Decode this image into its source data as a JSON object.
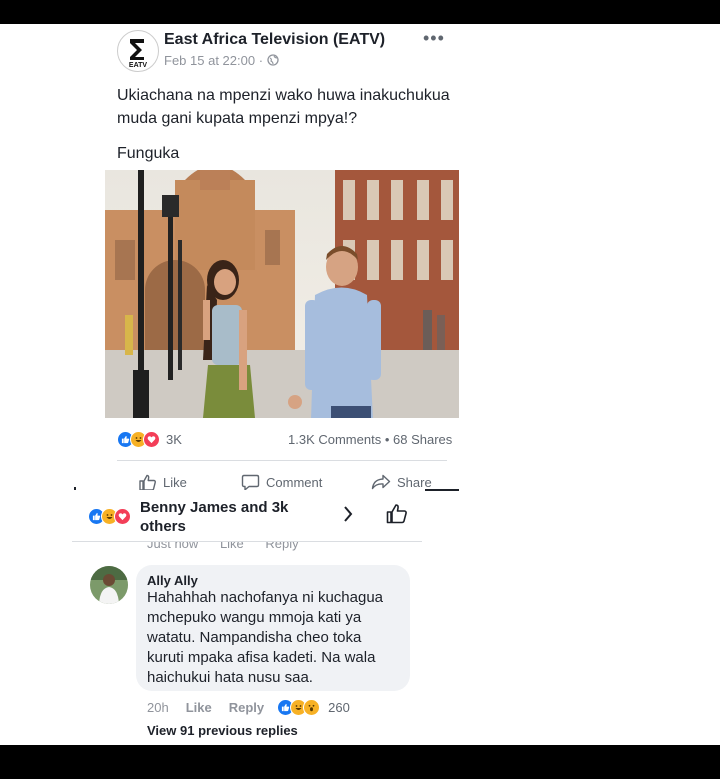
{
  "post": {
    "page_name": "East Africa Television (EATV)",
    "timestamp": "Feb 15 at 22:00",
    "privacy_icon": "globe-icon",
    "avatar_text": "EATV",
    "more_icon": "more-icon",
    "text_line1": "Ukiachana na mpenzi wako huwa inakuchukua",
    "text_line2": "muda gani kupata mpenzi mpya!?",
    "text_line3": "Funguka"
  },
  "engagement": {
    "reaction_count": "3K",
    "comments": "1.3K Comments",
    "shares": "68 Shares",
    "separator": "•"
  },
  "actions": {
    "like": "Like",
    "comment": "Comment",
    "share": "Share"
  },
  "likers": {
    "text": "Benny James and 3k others"
  },
  "prev_comment_meta": {
    "time": "Just now",
    "like": "Like",
    "reply": "Reply"
  },
  "comment": {
    "author": "Ally Ally",
    "text": "Hahahhah nachofanya ni kuchagua mchepuko wangu mmoja kati ya watatu. Nampandisha cheo toka kuruti mpaka afisa kadeti. Na wala haichukui hata nusu saa.",
    "time": "20h",
    "like": "Like",
    "reply": "Reply",
    "reaction_count": "260"
  },
  "view_previous": "View 91 previous replies",
  "colors": {
    "like_blue": "#1877f2",
    "haha_yellow": "#f7b125",
    "love_red": "#f33e58",
    "text_dark": "#1d2129",
    "text_gray": "#606770"
  }
}
